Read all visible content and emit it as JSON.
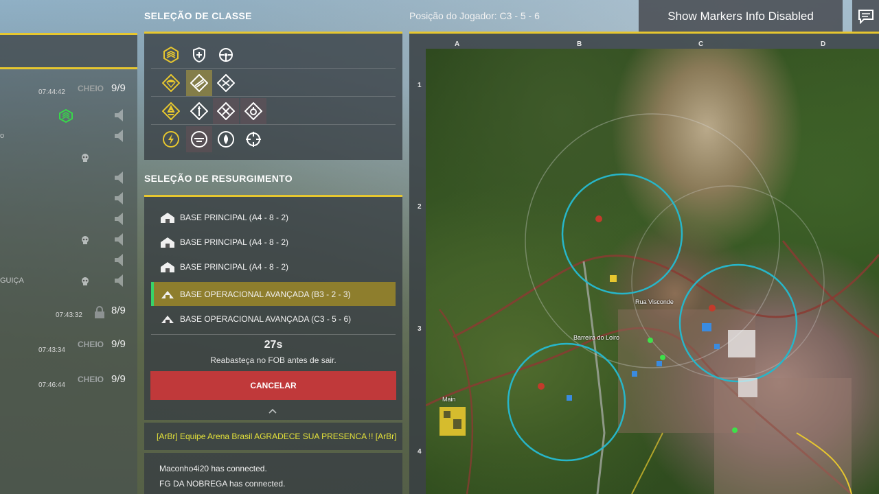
{
  "header": {
    "class_title": "SELEÇÃO DE CLASSE",
    "player_position": "Posição do Jogador: C3 - 5 - 6",
    "markers_button": "Show Markers Info Disabled"
  },
  "squads": {
    "rows": [
      {
        "time": "07:44:42",
        "status": "CHEIO",
        "count": "9/9"
      },
      {
        "time": "07:43:32",
        "status": "",
        "count": "8/9"
      },
      {
        "time": "07:43:34",
        "status": "CHEIO",
        "count": "9/9"
      },
      {
        "time": "07:46:44",
        "status": "CHEIO",
        "count": "9/9"
      }
    ],
    "side_text_1": "o",
    "side_text_2": "GUIÇA"
  },
  "respawn": {
    "title": "SELEÇÃO DE RESURGIMENTO",
    "spawns": [
      {
        "label": "BASE PRINCIPAL (A4 - 8 - 2)",
        "icon": "main-base-icon"
      },
      {
        "label": "BASE PRINCIPAL (A4 - 8 - 2)",
        "icon": "main-base-icon"
      },
      {
        "label": "BASE PRINCIPAL (A4 - 8 - 2)",
        "icon": "main-base-icon"
      },
      {
        "label": "BASE OPERACIONAL AVANÇADA (B3 - 2 - 3)",
        "icon": "fob-icon",
        "selected": true
      },
      {
        "label": "BASE OPERACIONAL AVANÇADA (C3 - 5 - 6)",
        "icon": "fob-icon"
      }
    ],
    "timer": "27s",
    "refill_text": "Reabasteça no FOB antes de sair.",
    "cancel_label": "CANCELAR"
  },
  "chat": {
    "banner": "[ArBr] Equipe Arena Brasil AGRADECE SUA PRESENCA !! [ArBr]",
    "lines": [
      "Maconho4i20 has connected.",
      "FG DA NOBREGA has connected."
    ]
  },
  "map": {
    "columns": [
      "A",
      "B",
      "C",
      "D"
    ],
    "rows": [
      "1",
      "2",
      "3",
      "4"
    ],
    "labels": {
      "rua_visconde": "Rua Visconde",
      "barreira": "Barreira do Loiro",
      "main": "Main"
    }
  },
  "colors": {
    "accent": "#e7c72f",
    "cancel": "#c0393a",
    "selected": "#8e7e2d",
    "radius_ring": "#27b6c9"
  }
}
